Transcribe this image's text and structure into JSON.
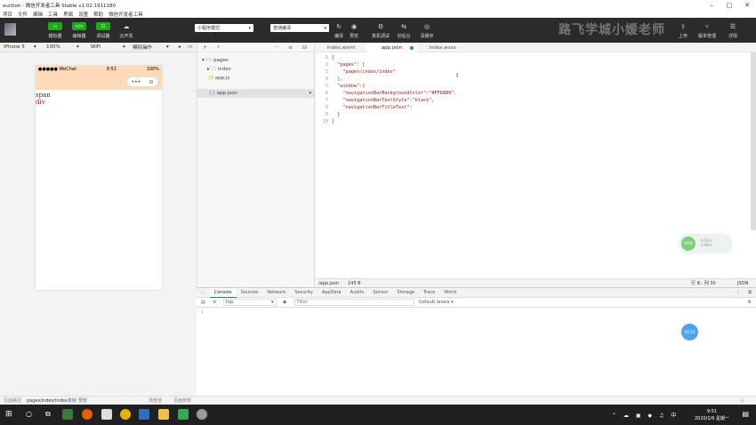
{
  "window": {
    "title": "auction - 微信开发者工具 Stable v1.02.1911180",
    "controls": [
      "–",
      "□",
      "✕"
    ]
  },
  "menubar": [
    "项目",
    "文件",
    "编辑",
    "工具",
    "界面",
    "设置",
    "帮助",
    "微信开发者工具"
  ],
  "toolbar": {
    "left_buttons": [
      {
        "label": "模拟器",
        "icon": "▭"
      },
      {
        "label": "编辑器",
        "icon": "</>"
      },
      {
        "label": "调试器",
        "icon": "⊡"
      },
      {
        "label": "云开发",
        "icon": "☁"
      }
    ],
    "mode_select": "小程序模式",
    "compile_select": "普通编译",
    "mid_buttons": [
      {
        "label": "编译",
        "icon": "↻"
      },
      {
        "label": "预览",
        "icon": "◉"
      },
      {
        "label": "真机调试",
        "icon": "⚙"
      },
      {
        "label": "切后台",
        "icon": "⇆"
      },
      {
        "label": "清缓存",
        "icon": "◎"
      }
    ],
    "watermark": "路飞学城小媛老师",
    "right_buttons": [
      {
        "label": "上传",
        "icon": "⇧"
      },
      {
        "label": "版本管理",
        "icon": "⑂"
      },
      {
        "label": "详情",
        "icon": "☰"
      }
    ]
  },
  "simbar": {
    "device": "iPhone 5",
    "zoom": "100%",
    "network": "WiFi",
    "operation": "模拟操作"
  },
  "phone": {
    "carrier": "●●●●● WeChat",
    "time": "9:51",
    "battery": "100%",
    "capsule_dots": "•••",
    "capsule_close": "⊙",
    "span_text": "span",
    "div_text": "div",
    "div_color": "#ff0000",
    "nav_bg": "#FFDAB9"
  },
  "explorer": {
    "files": [
      {
        "name": "pages",
        "indent": 0,
        "type": "folder-open"
      },
      {
        "name": "index",
        "indent": 1,
        "type": "folder"
      },
      {
        "name": "app.js",
        "indent": 1,
        "type": "js"
      },
      {
        "name": "app.json",
        "indent": 1,
        "type": "json",
        "selected": true
      }
    ]
  },
  "editor": {
    "tabs": [
      {
        "label": "index.wxml",
        "active": false
      },
      {
        "label": "app.json",
        "active": true,
        "modified": true
      },
      {
        "label": "index.wxss",
        "active": false
      }
    ],
    "lines": [
      {
        "n": "1",
        "text": "{"
      },
      {
        "n": "2",
        "text": "  \"pages\": ["
      },
      {
        "n": "3",
        "text": "    \"pages/index/index\""
      },
      {
        "n": "4",
        "text": "  ],"
      },
      {
        "n": "5",
        "text": "  \"window\":{"
      },
      {
        "n": "6",
        "text": "    \"navigationBarBackgroundColor\":\"#FFDAB9\","
      },
      {
        "n": "7",
        "text": "    \"navigationBarTextStyle\":\"black\","
      },
      {
        "n": "8",
        "text": "    \"navigationBarTitleText\":"
      },
      {
        "n": "9",
        "text": "  }"
      },
      {
        "n": "10",
        "text": "}"
      }
    ],
    "status_path": "/app.json",
    "status_size": "145 B",
    "status_position": "行 8，列 30",
    "status_lang": "JSON"
  },
  "float_widget": {
    "percent": "40%",
    "line1": "0.5K/s",
    "line2": "0.4K/s"
  },
  "debugger": {
    "tabs": [
      "Console",
      "Sources",
      "Network",
      "Security",
      "AppData",
      "Audits",
      "Sensor",
      "Storage",
      "Trace",
      "Wxml"
    ],
    "active_tab": "Console",
    "context": "top",
    "filter_placeholder": "Filter",
    "levels": "Default levels ▾",
    "prompt": "›"
  },
  "blue_bubble": "00:10",
  "bottom_status": {
    "path_label": "页面路径",
    "path": "pages/index/index",
    "copy": "复制",
    "preview": "预览",
    "scene": "场景值",
    "params": "页面参数"
  },
  "taskbar": {
    "time": "9:51",
    "date": "2020/1/6 星期一"
  }
}
